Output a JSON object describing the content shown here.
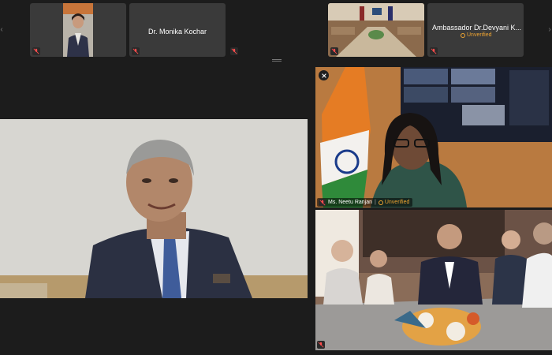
{
  "top_strip": {
    "tile2_name": "Dr. Monika Kochar",
    "tile4_name": "Ambassador Dr.Devyani K...",
    "tile4_status": "Unverified"
  },
  "right_top": {
    "name": "Ms. Neetu Ranjan",
    "status": "Unverified"
  },
  "colors": {
    "background": "#1c1c1c",
    "tile": "#3a3a3a",
    "unverified": "#f0a532"
  },
  "icons": {
    "muted": "mic-off-icon",
    "pinned": "pin-icon",
    "unverified": "unverified-icon",
    "scroll_left": "chevron-left-icon",
    "scroll_right": "chevron-right-icon"
  }
}
